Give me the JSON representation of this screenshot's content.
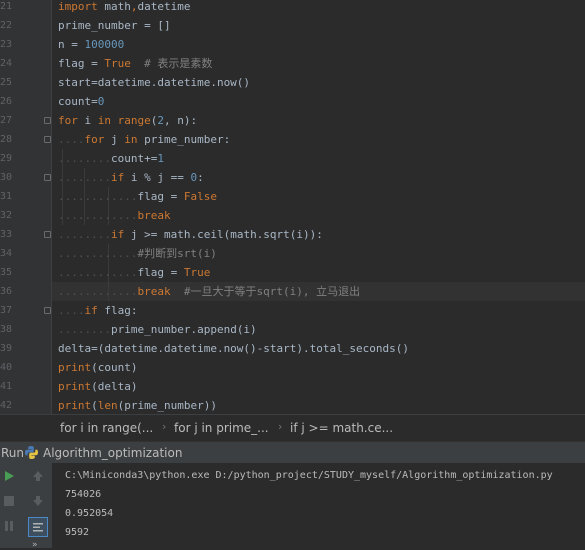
{
  "editor": {
    "line_numbers": [
      "21",
      "22",
      "23",
      "24",
      "25",
      "26",
      "27",
      "28",
      "29",
      "30",
      "31",
      "32",
      "33",
      "34",
      "35",
      "36",
      "37",
      "38",
      "39",
      "40",
      "41",
      "42"
    ],
    "lines": [
      {
        "tokens": [
          {
            "t": "import",
            "c": "kw"
          },
          {
            "t": " math",
            "c": ""
          },
          {
            "t": ",",
            "c": "kw"
          },
          {
            "t": "datetime",
            "c": ""
          }
        ]
      },
      {
        "tokens": [
          {
            "t": "prime_number = []",
            "c": ""
          }
        ]
      },
      {
        "tokens": [
          {
            "t": "n = ",
            "c": ""
          },
          {
            "t": "100000",
            "c": "num"
          }
        ]
      },
      {
        "tokens": [
          {
            "t": "flag = ",
            "c": ""
          },
          {
            "t": "True",
            "c": "kw"
          },
          {
            "t": "  # 表示是素数",
            "c": "cmt"
          }
        ]
      },
      {
        "tokens": [
          {
            "t": "start=datetime.datetime.now()",
            "c": ""
          }
        ]
      },
      {
        "tokens": [
          {
            "t": "count=",
            "c": ""
          },
          {
            "t": "0",
            "c": "num"
          }
        ]
      },
      {
        "tokens": [
          {
            "t": "for",
            "c": "kw"
          },
          {
            "t": " i ",
            "c": ""
          },
          {
            "t": "in",
            "c": "kw"
          },
          {
            "t": " ",
            "c": ""
          },
          {
            "t": "range",
            "c": "kw"
          },
          {
            "t": "(",
            "c": ""
          },
          {
            "t": "2",
            "c": "num"
          },
          {
            "t": ", n):",
            "c": ""
          }
        ]
      },
      {
        "tokens": [
          {
            "t": "....",
            "c": "dot"
          },
          {
            "t": "for",
            "c": "kw"
          },
          {
            "t": " j ",
            "c": ""
          },
          {
            "t": "in",
            "c": "kw"
          },
          {
            "t": " prime_number:",
            "c": ""
          }
        ]
      },
      {
        "tokens": [
          {
            "t": "........",
            "c": "dot"
          },
          {
            "t": "count+=",
            "c": ""
          },
          {
            "t": "1",
            "c": "num"
          }
        ]
      },
      {
        "tokens": [
          {
            "t": "........",
            "c": "dot"
          },
          {
            "t": "if",
            "c": "kw"
          },
          {
            "t": " i % j == ",
            "c": ""
          },
          {
            "t": "0",
            "c": "num"
          },
          {
            "t": ":",
            "c": ""
          }
        ]
      },
      {
        "tokens": [
          {
            "t": "............",
            "c": "dot"
          },
          {
            "t": "flag = ",
            "c": ""
          },
          {
            "t": "False",
            "c": "kw"
          }
        ]
      },
      {
        "tokens": [
          {
            "t": "............",
            "c": "dot"
          },
          {
            "t": "break",
            "c": "kw"
          }
        ]
      },
      {
        "tokens": [
          {
            "t": "........",
            "c": "dot"
          },
          {
            "t": "if",
            "c": "kw"
          },
          {
            "t": " j >= math.ceil(math.sqrt(i)):",
            "c": ""
          }
        ]
      },
      {
        "tokens": [
          {
            "t": "............",
            "c": "dot"
          },
          {
            "t": "#判断到srt(i)",
            "c": "cmt"
          }
        ]
      },
      {
        "tokens": [
          {
            "t": "............",
            "c": "dot"
          },
          {
            "t": "flag = ",
            "c": ""
          },
          {
            "t": "True",
            "c": "kw"
          }
        ]
      },
      {
        "tokens": [
          {
            "t": "............",
            "c": "dot"
          },
          {
            "t": "break",
            "c": "kw"
          },
          {
            "t": "  #一旦大于等于sqrt(i), 立马退出",
            "c": "cmt"
          }
        ]
      },
      {
        "tokens": [
          {
            "t": "....",
            "c": "dot"
          },
          {
            "t": "if",
            "c": "kw"
          },
          {
            "t": " flag:",
            "c": ""
          }
        ]
      },
      {
        "tokens": [
          {
            "t": "........",
            "c": "dot"
          },
          {
            "t": "prime_number.append(i)",
            "c": ""
          }
        ]
      },
      {
        "tokens": [
          {
            "t": "delta=(datetime.datetime.now()-start).total_seconds()",
            "c": ""
          }
        ]
      },
      {
        "tokens": [
          {
            "t": "print",
            "c": "kw"
          },
          {
            "t": "(count)",
            "c": ""
          }
        ]
      },
      {
        "tokens": [
          {
            "t": "print",
            "c": "kw"
          },
          {
            "t": "(delta)",
            "c": ""
          }
        ]
      },
      {
        "tokens": [
          {
            "t": "print",
            "c": "kw"
          },
          {
            "t": "(",
            "c": ""
          },
          {
            "t": "len",
            "c": "kw"
          },
          {
            "t": "(prime_number))",
            "c": ""
          }
        ]
      }
    ]
  },
  "breadcrumbs": [
    "for i in range(...",
    "for j in prime_...",
    "if j >= math.ce..."
  ],
  "run": {
    "label": "Run",
    "config_name": "Algorithm_optimization",
    "output": [
      "C:\\Miniconda3\\python.exe D:/python_project/STUDY_myself/Algorithm_optimization.py",
      "754026",
      "0.952054",
      "9592"
    ]
  },
  "colors": {
    "keyword": "#cc7832",
    "number": "#6897bb",
    "comment": "#808080",
    "text": "#a9b7c6",
    "background": "#2b2b2b"
  }
}
